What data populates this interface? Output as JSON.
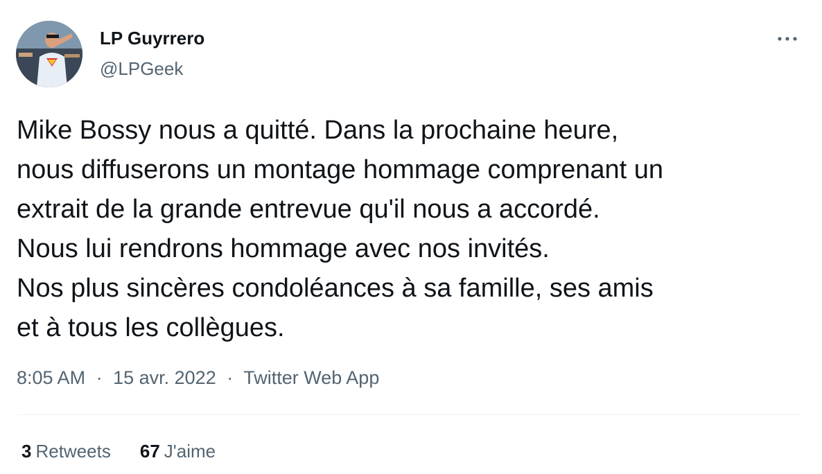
{
  "user": {
    "display_name": "LP Guyrrero",
    "handle": "@LPGeek"
  },
  "tweet": {
    "lines": [
      "Mike Bossy nous a quitté. Dans la prochaine heure,",
      "nous diffuserons un montage hommage comprenant un",
      "extrait de la grande entrevue qu'il nous a accordé.",
      "Nous lui rendrons hommage avec nos invités.",
      "Nos plus sincères condoléances à sa famille, ses amis",
      "et à tous les collègues."
    ],
    "time": "8:05 AM",
    "date": "15 avr. 2022",
    "separator": "·",
    "source": "Twitter Web App"
  },
  "stats": {
    "retweets_count": "3",
    "retweets_label": "Retweets",
    "likes_count": "67",
    "likes_label": "J'aime"
  },
  "icons": {
    "more": "more-horizontal-icon"
  },
  "colors": {
    "text_primary": "#0f1419",
    "text_secondary": "#536471",
    "divider": "#eff3f4"
  }
}
